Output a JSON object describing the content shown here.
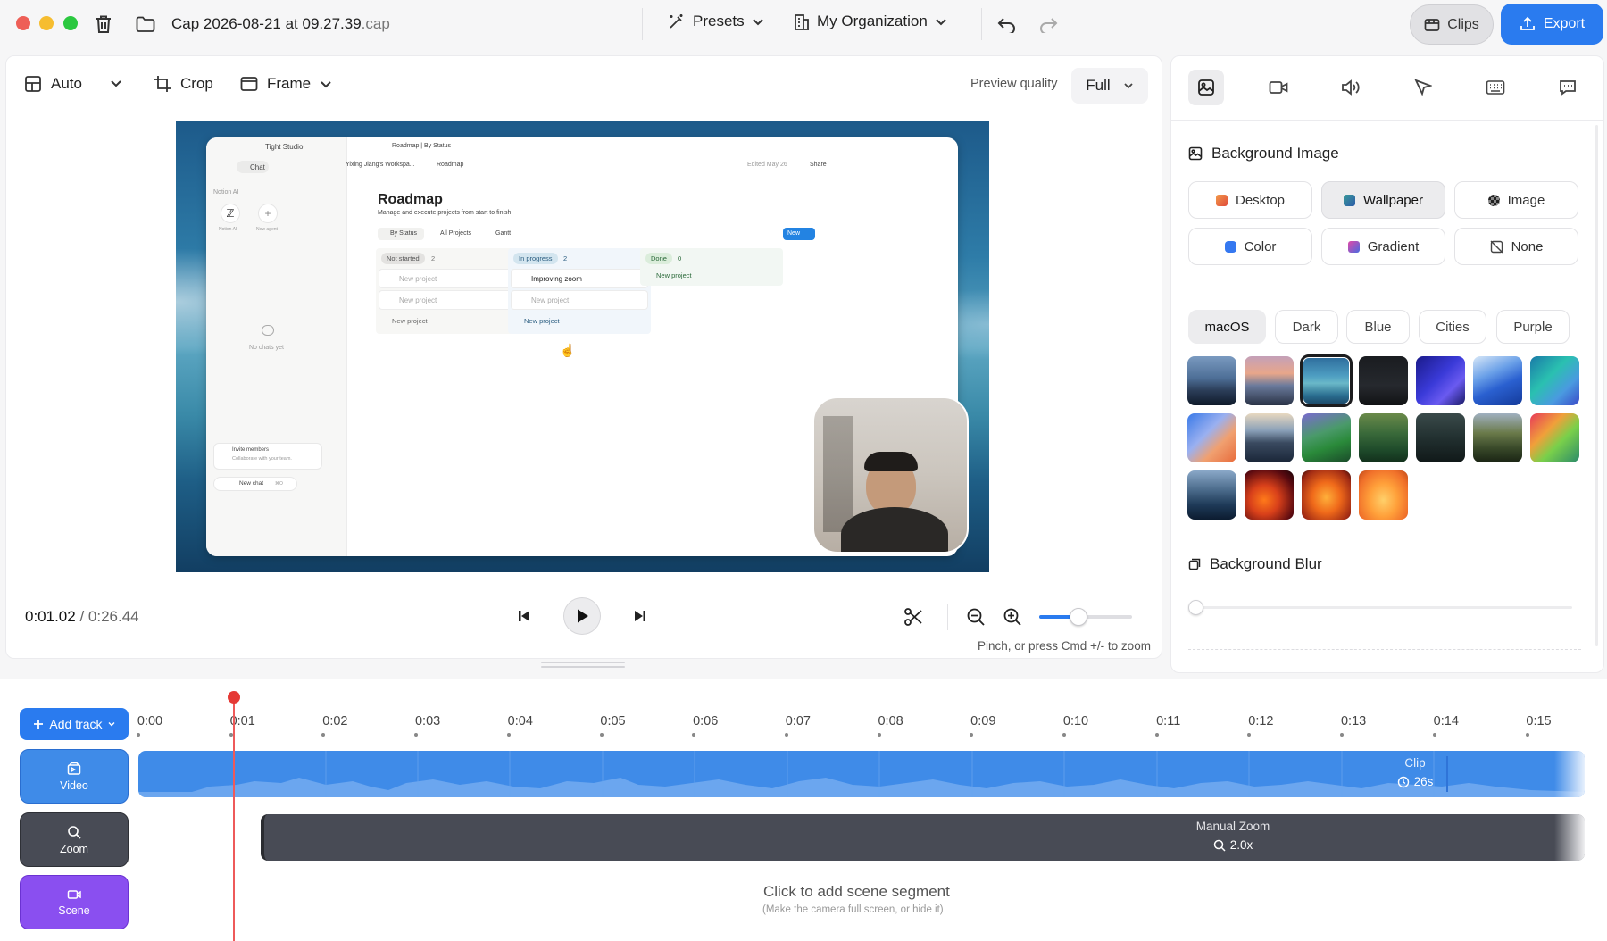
{
  "titlebar": {
    "filename_main": "Cap 2026-08-21 at 09.27.39",
    "filename_ext": ".cap",
    "presets_label": "Presets",
    "org_label": "My Organization",
    "clips_label": "Clips",
    "export_label": "Export",
    "traffic_colors": [
      "#ee5f57",
      "#f6bd30",
      "#2bc840"
    ]
  },
  "toolbar": {
    "auto_label": "Auto",
    "crop_label": "Crop",
    "frame_label": "Frame",
    "preview_quality_label": "Preview quality",
    "preview_quality_value": "Full"
  },
  "preview": {
    "app_name": "Tight Studio",
    "tab_title": "Roadmap | By Status",
    "breadcrumb_workspace": "Yixing Jiang's Workspa...",
    "breadcrumb_page": "Roadmap",
    "edited": "Edited May 26",
    "share": "Share",
    "chat_tab": "Chat",
    "notion_ai_section": "Notion AI",
    "notion_ai_label": "Notion AI",
    "new_agent_label": "New agent",
    "no_chats": "No chats yet",
    "invite_title": "Invite members",
    "invite_sub": "Collaborate with your team.",
    "new_chat": "New chat",
    "new_chat_kbd": "⌘O",
    "page_title": "Roadmap",
    "page_desc": "Manage and execute projects from start to finish.",
    "views": [
      "By Status",
      "All Projects",
      "Gantt"
    ],
    "new_button": "New",
    "columns": [
      {
        "status": "Not started",
        "count": "2",
        "cards": [
          "New project",
          "New project"
        ],
        "add": "New project"
      },
      {
        "status": "In progress",
        "count": "2",
        "cards": [
          "Improving zoom",
          "New project"
        ],
        "add": "New project"
      },
      {
        "status": "Done",
        "count": "0",
        "cards": [],
        "add": "New project"
      }
    ]
  },
  "transport": {
    "current_time": "0:01.02",
    "total_time": "/ 0:26.44",
    "zoom_hint": "Pinch, or press Cmd +/- to zoom",
    "zoom_level": 0.42
  },
  "right_panel": {
    "bg_image_title": "Background Image",
    "bg_types": [
      {
        "label": "Desktop",
        "selected": false
      },
      {
        "label": "Wallpaper",
        "selected": true
      },
      {
        "label": "Image",
        "selected": false
      },
      {
        "label": "Color",
        "selected": false
      },
      {
        "label": "Gradient",
        "selected": false
      },
      {
        "label": "None",
        "selected": false
      }
    ],
    "categories": [
      {
        "label": "macOS",
        "selected": true
      },
      {
        "label": "Dark",
        "selected": false
      },
      {
        "label": "Blue",
        "selected": false
      },
      {
        "label": "Cities",
        "selected": false
      },
      {
        "label": "Purple",
        "selected": false
      }
    ],
    "bg_blur_title": "Background Blur",
    "blur_value": 0
  },
  "timeline": {
    "add_track_label": "Add track",
    "ticks": [
      "0:00",
      "0:01",
      "0:02",
      "0:03",
      "0:04",
      "0:05",
      "0:06",
      "0:07",
      "0:08",
      "0:09",
      "0:10",
      "0:11",
      "0:12",
      "0:13",
      "0:14",
      "0:15"
    ],
    "tracks": {
      "video": "Video",
      "zoom": "Zoom",
      "scene": "Scene"
    },
    "clip_label": "Clip",
    "clip_duration": "26s",
    "zoom_segment_label": "Manual Zoom",
    "zoom_segment_value": "2.0x",
    "scene_hint": "Click to add scene segment",
    "scene_sub": "(Make the camera full screen, or hide it)"
  }
}
